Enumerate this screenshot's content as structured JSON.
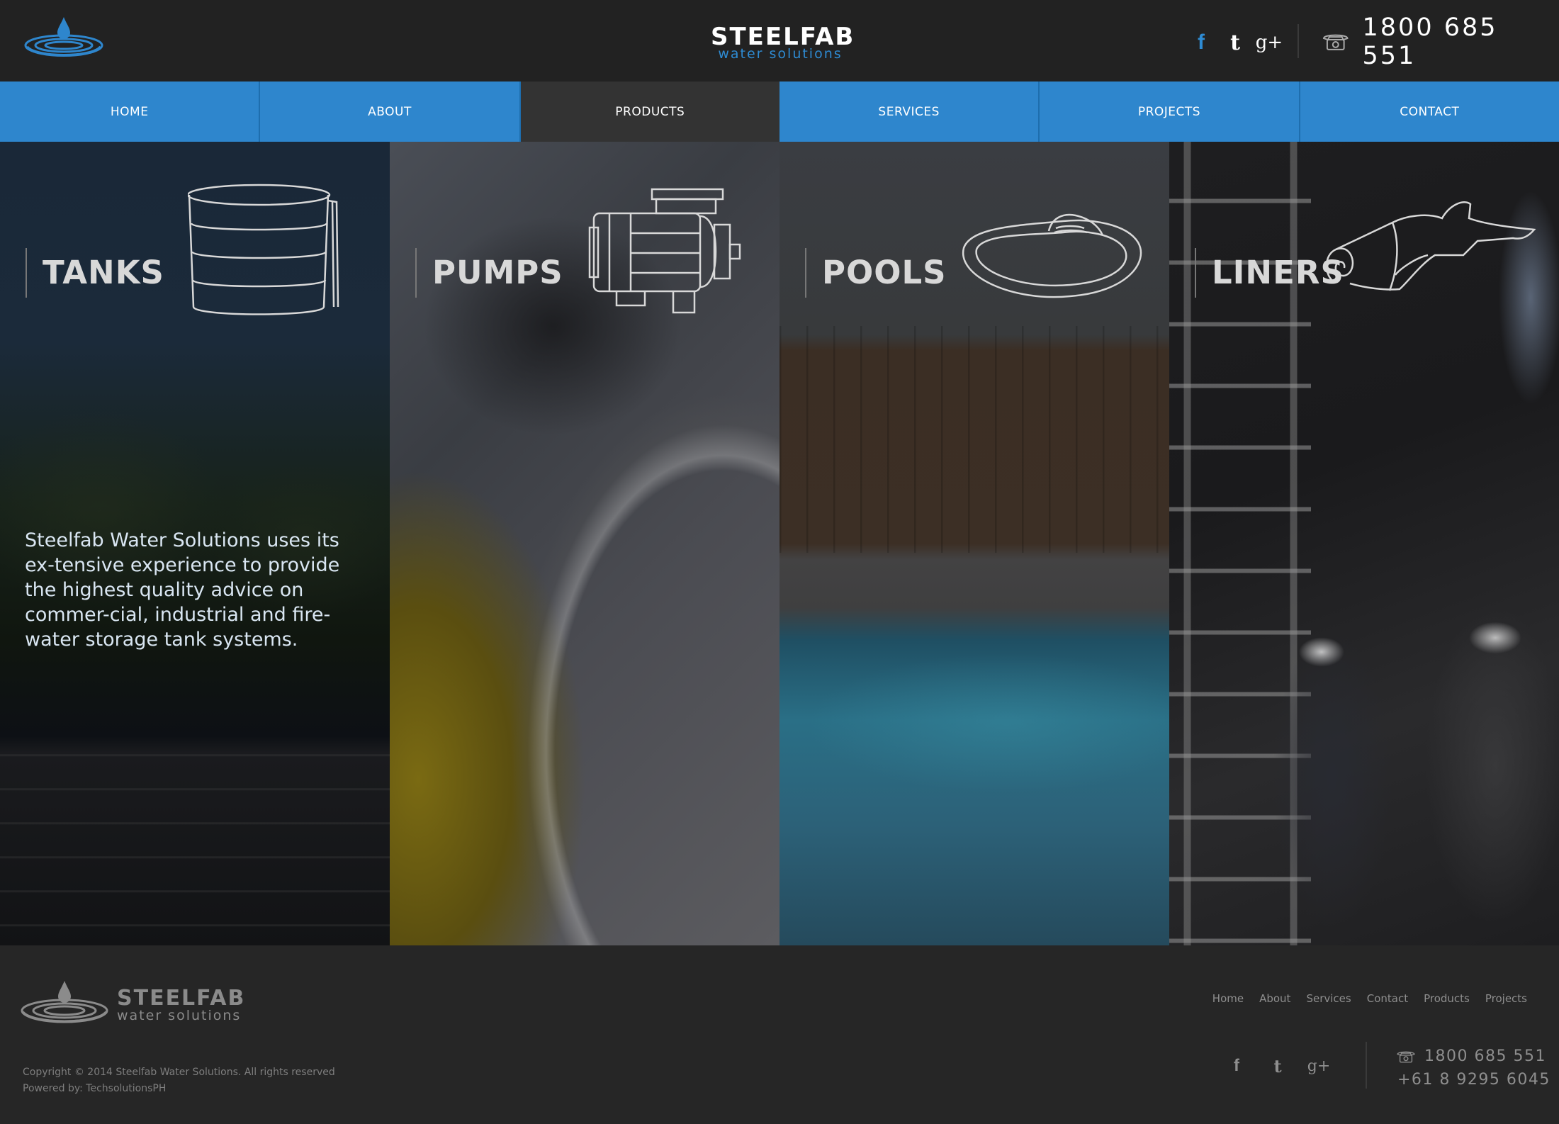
{
  "header": {
    "brand_name": "STEELFAB",
    "brand_sub": "water solutions",
    "phone": "1800 685 551"
  },
  "social": {
    "facebook": "f",
    "twitter": "t",
    "googleplus": "g+"
  },
  "nav": {
    "items": [
      {
        "label": "HOME",
        "active": false
      },
      {
        "label": "ABOUT",
        "active": false
      },
      {
        "label": "PRODUCTS",
        "active": true
      },
      {
        "label": "SERVICES",
        "active": false
      },
      {
        "label": "PROJECTS",
        "active": false
      },
      {
        "label": "CONTACT",
        "active": false
      }
    ]
  },
  "panels": [
    {
      "title": "TANKS",
      "icon": "tank-icon",
      "description": "Steelfab Water Solutions uses its ex-tensive experience to provide the highest quality advice on commer-cial, industrial and fire-water storage tank systems."
    },
    {
      "title": "PUMPS",
      "icon": "pump-icon"
    },
    {
      "title": "POOLS",
      "icon": "pool-icon"
    },
    {
      "title": "LINERS",
      "icon": "liner-roll-icon"
    }
  ],
  "footer": {
    "brand_name": "STEELFAB",
    "brand_sub": "water solutions",
    "links": [
      "Home",
      "About",
      "Services",
      "Contact",
      "Products",
      "Projects"
    ],
    "phone1": "1800 685 551",
    "phone2": "+61 8 9295 6045",
    "copyright": "Copyright © 2014 Steelfab Water Solutions. All rights reserved",
    "powered": "Powered by: TechsolutionsPH"
  },
  "colors": {
    "accent_blue": "#2e86cd",
    "header_bg": "#222222",
    "active_nav": "#333333",
    "footer_bg": "#262626"
  }
}
